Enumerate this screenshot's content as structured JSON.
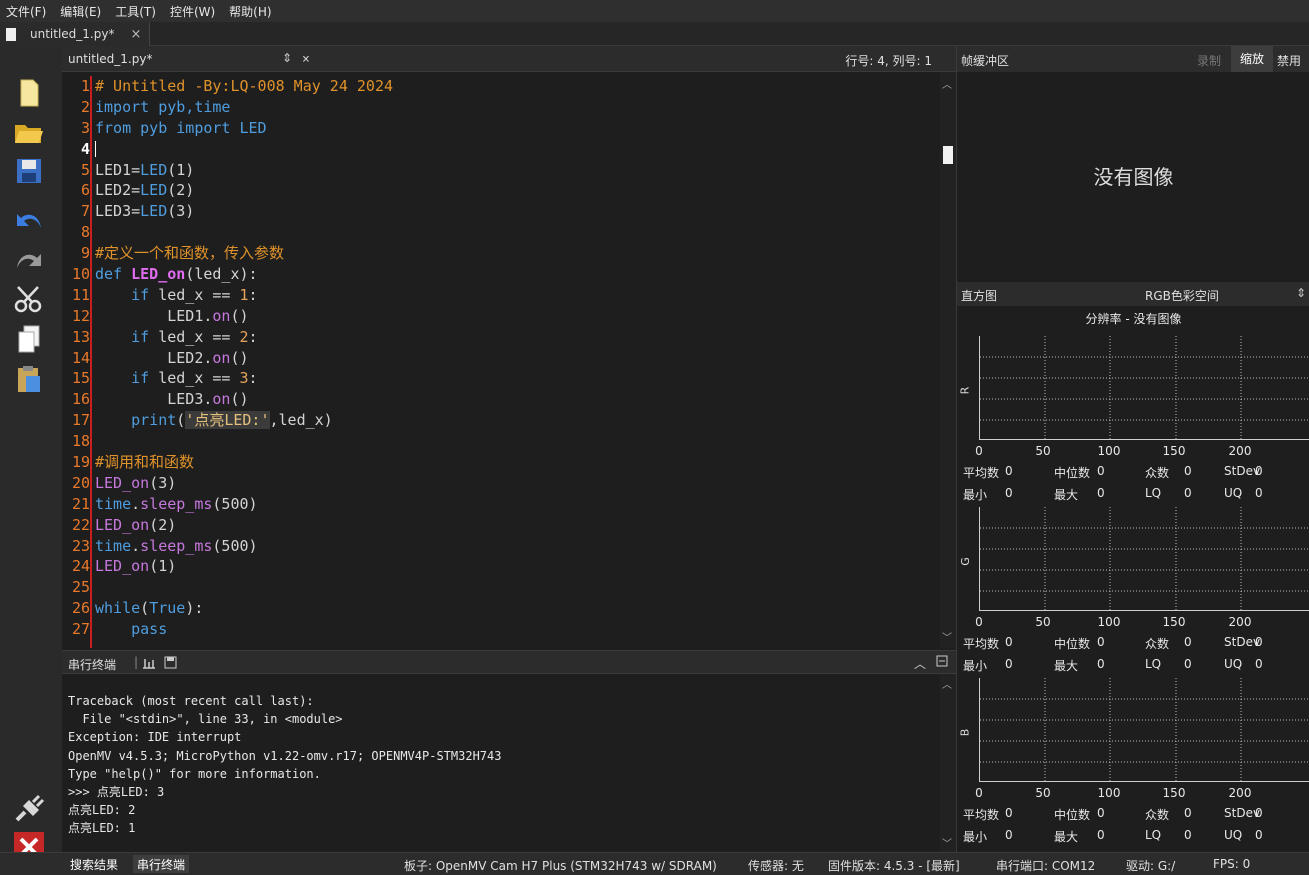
{
  "menu": [
    "文件(F)",
    "编辑(E)",
    "工具(T)",
    "控件(W)",
    "帮助(H)"
  ],
  "file_tab": {
    "label": "untitled_1.py*",
    "close": "×"
  },
  "editor_header": {
    "filename": "untitled_1.py*",
    "dropdown": "⇕",
    "close": "×",
    "position": "行号: 4, 列号: 1"
  },
  "code_lines": [
    "1",
    "2",
    "3",
    "4",
    "5",
    "6",
    "7",
    "8",
    "9",
    "10",
    "11",
    "12",
    "13",
    "14",
    "15",
    "16",
    "17",
    "18",
    "19",
    "20",
    "21",
    "22",
    "23",
    "24",
    "25",
    "26",
    "27"
  ],
  "code": {
    "l1": "# Untitled -By:LQ-008 May 24 2024",
    "l2a": "import",
    "l2b": " pyb,time",
    "l3a": "from",
    "l3b": " pyb ",
    "l3c": "import",
    "l3d": " LED",
    "l5a": "LED1=",
    "l5b": "LED",
    "l5c": "(1)",
    "l6a": "LED2=",
    "l6b": "LED",
    "l6c": "(2)",
    "l7a": "LED3=",
    "l7b": "LED",
    "l7c": "(3)",
    "l9": "#定义一个和函数，传入参数",
    "l10a": "def",
    "l10b": " ",
    "l10c": "LED_on",
    "l10d": "(led_x):",
    "l11a": "    if",
    "l11b": " led_x == ",
    "l11c": "1",
    "l11d": ":",
    "l12a": "        LED1.",
    "l12b": "on",
    "l12c": "()",
    "l13a": "    if",
    "l13b": " led_x == ",
    "l13c": "2",
    "l13d": ":",
    "l14a": "        LED2.",
    "l14b": "on",
    "l14c": "()",
    "l15a": "    if",
    "l15b": " led_x == ",
    "l15c": "3",
    "l15d": ":",
    "l16a": "        LED3.",
    "l16b": "on",
    "l16c": "()",
    "l17a": "    print",
    "l17b": "(",
    "l17c": "'点亮LED:'",
    "l17d": ",led_x)",
    "l19": "#调用和和函数",
    "l20a": "LED_on",
    "l20b": "(3)",
    "l21a": "time",
    "l21b": ".",
    "l21c": "sleep_ms",
    "l21d": "(500)",
    "l22a": "LED_on",
    "l22b": "(2)",
    "l23a": "time",
    "l23b": ".",
    "l23c": "sleep_ms",
    "l23d": "(500)",
    "l24a": "LED_on",
    "l24b": "(1)",
    "l26a": "while",
    "l26b": "(",
    "l26c": "True",
    "l26d": "):",
    "l27": "    pass"
  },
  "terminal": {
    "title": "串行终端",
    "lines": [
      "Traceback (most recent call last):",
      "  File \"<stdin>\", line 33, in <module>",
      "Exception: IDE interrupt",
      "OpenMV v4.5.3; MicroPython v1.22-omv.r17; OPENMV4P-STM32H743",
      "Type \"help()\" for more information.",
      ">>> 点亮LED: 3",
      "点亮LED: 2",
      "点亮LED: 1"
    ]
  },
  "framebuffer": {
    "title": "帧缓冲区",
    "record": "录制",
    "zoom": "缩放",
    "disable": "禁用",
    "no_image": "没有图像"
  },
  "histogram": {
    "title": "直方图",
    "colorspace": "RGB色彩空间",
    "resolution": "分辨率 - 没有图像",
    "channels": [
      "R",
      "G",
      "B"
    ],
    "ticks": [
      "0",
      "50",
      "100",
      "150",
      "200"
    ],
    "stats_row1": [
      "平均数",
      "0",
      "中位数",
      "0",
      "众数",
      "0",
      "StDev",
      "0"
    ],
    "stats_row2": [
      "最小",
      "0",
      "最大",
      "0",
      "LQ",
      "0",
      "UQ",
      "0"
    ]
  },
  "status": {
    "tab_search": "搜索结果",
    "tab_terminal": "串行终端",
    "board": "板子: OpenMV Cam H7 Plus (STM32H743 w/ SDRAM)",
    "sensor": "传感器: 无",
    "firmware": "固件版本: 4.5.3 - [最新]",
    "port": "串行端口: COM12",
    "drive": "驱动: G:/",
    "fps": "FPS: 0"
  }
}
